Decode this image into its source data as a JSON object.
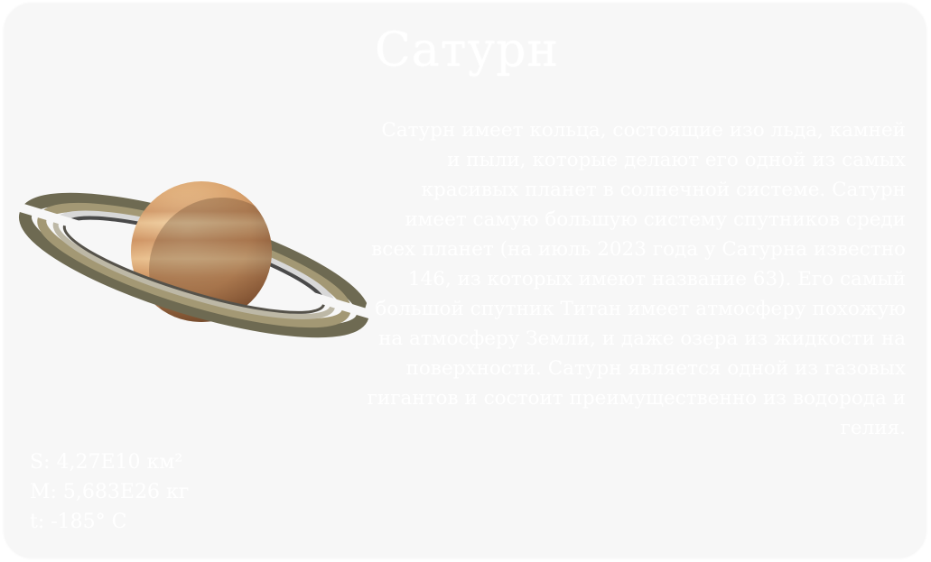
{
  "planet": {
    "name": "Сатурн",
    "description": "Сатурн имеет кольца, состоящие изо льда, камней и пыли, которые делают его одной из самых красивых планет в солнечной системе. Сатурн имеет самую большую систему спутников среди всех планет (на июль 2023 года у Сатурна известно 146, из которых имеют название 63). Его самый большой спутник Титан имеет атмосферу похожую на атмосферу Земли, и даже озера из жидкости на поверхности. Сатурн является одной из газовых гигантов и состоит преимущественно из водорода и гелия.",
    "stats": {
      "area": "S: 4,27E10 км²",
      "mass": "M: 5,683E26 кг",
      "temperature": "t: -185° C"
    }
  },
  "colors": {
    "card_background": "#f7f7f7",
    "text": "#ffffff",
    "planet_body": "#e3b47c",
    "ring": "#8c8466"
  },
  "image": {
    "icon": "saturn-image"
  }
}
